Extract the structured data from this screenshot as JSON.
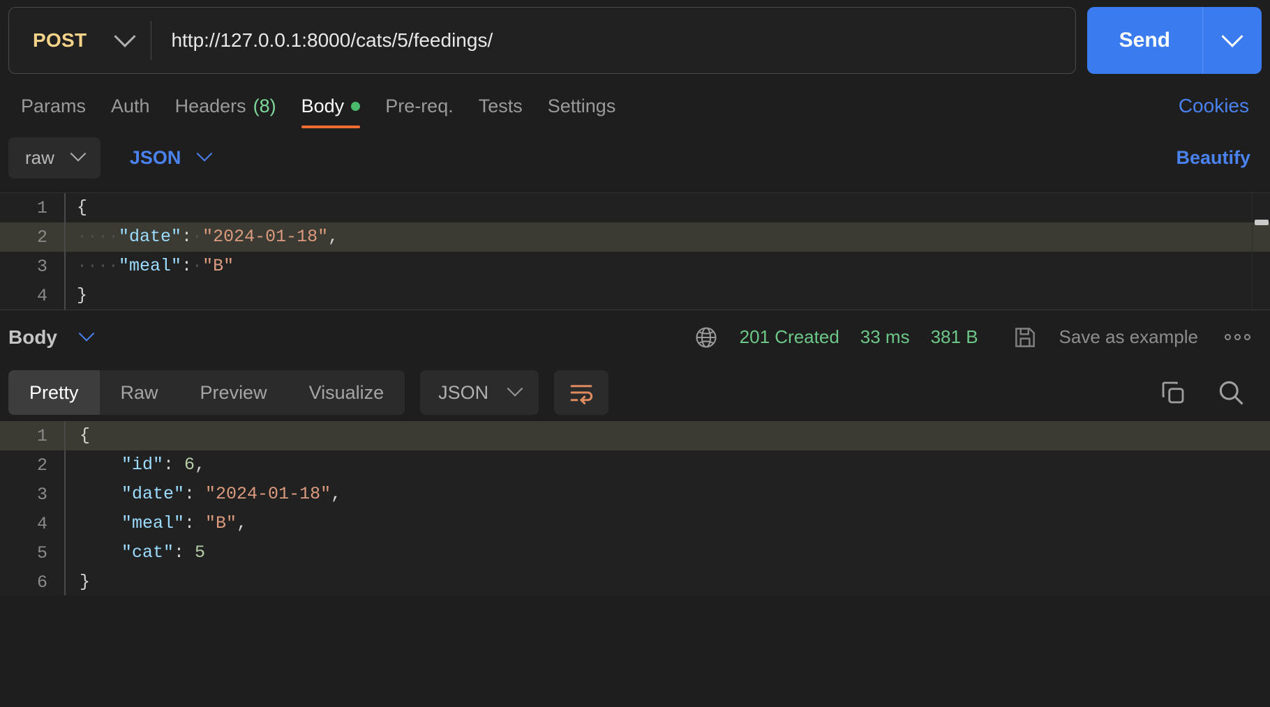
{
  "request": {
    "method": "POST",
    "url": "http://127.0.0.1:8000/cats/5/feedings/",
    "send_label": "Send",
    "tabs": [
      {
        "label": "Params",
        "active": false
      },
      {
        "label": "Auth",
        "active": false
      },
      {
        "label": "Headers",
        "count": "(8)",
        "active": false
      },
      {
        "label": "Body",
        "active": true,
        "dot": true
      },
      {
        "label": "Pre-req.",
        "active": false
      },
      {
        "label": "Tests",
        "active": false
      },
      {
        "label": "Settings",
        "active": false
      }
    ],
    "cookies_label": "Cookies",
    "body_mode": "raw",
    "body_format": "JSON",
    "beautify_label": "Beautify",
    "body_lines": [
      {
        "num": "1",
        "highlight": false,
        "tokens": [
          {
            "t": "pun",
            "v": "{"
          }
        ]
      },
      {
        "num": "2",
        "highlight": true,
        "tokens": [
          {
            "t": "ws",
            "v": "····"
          },
          {
            "t": "key",
            "v": "\"date\""
          },
          {
            "t": "pun",
            "v": ":"
          },
          {
            "t": "ws",
            "v": "·"
          },
          {
            "t": "str",
            "v": "\"2024-01-18\""
          },
          {
            "t": "pun",
            "v": ","
          }
        ]
      },
      {
        "num": "3",
        "highlight": false,
        "tokens": [
          {
            "t": "ws",
            "v": "····"
          },
          {
            "t": "key",
            "v": "\"meal\""
          },
          {
            "t": "pun",
            "v": ":"
          },
          {
            "t": "ws",
            "v": "·"
          },
          {
            "t": "str",
            "v": "\"B\""
          }
        ]
      },
      {
        "num": "4",
        "highlight": false,
        "tokens": [
          {
            "t": "pun",
            "v": "}"
          }
        ]
      }
    ]
  },
  "response": {
    "body_label": "Body",
    "status": "201 Created",
    "time": "33 ms",
    "size": "381 B",
    "save_example_label": "Save as example",
    "tabs": [
      {
        "label": "Pretty",
        "active": true
      },
      {
        "label": "Raw",
        "active": false
      },
      {
        "label": "Preview",
        "active": false
      },
      {
        "label": "Visualize",
        "active": false
      }
    ],
    "format": "JSON",
    "body_lines": [
      {
        "num": "1",
        "highlight": true,
        "tokens": [
          {
            "t": "pun",
            "v": "{"
          }
        ]
      },
      {
        "num": "2",
        "highlight": false,
        "tokens": [
          {
            "t": "pun",
            "v": "    "
          },
          {
            "t": "key",
            "v": "\"id\""
          },
          {
            "t": "pun",
            "v": ": "
          },
          {
            "t": "num",
            "v": "6"
          },
          {
            "t": "pun",
            "v": ","
          }
        ]
      },
      {
        "num": "3",
        "highlight": false,
        "tokens": [
          {
            "t": "pun",
            "v": "    "
          },
          {
            "t": "key",
            "v": "\"date\""
          },
          {
            "t": "pun",
            "v": ": "
          },
          {
            "t": "str",
            "v": "\"2024-01-18\""
          },
          {
            "t": "pun",
            "v": ","
          }
        ]
      },
      {
        "num": "4",
        "highlight": false,
        "tokens": [
          {
            "t": "pun",
            "v": "    "
          },
          {
            "t": "key",
            "v": "\"meal\""
          },
          {
            "t": "pun",
            "v": ": "
          },
          {
            "t": "str",
            "v": "\"B\""
          },
          {
            "t": "pun",
            "v": ","
          }
        ]
      },
      {
        "num": "5",
        "highlight": false,
        "tokens": [
          {
            "t": "pun",
            "v": "    "
          },
          {
            "t": "key",
            "v": "\"cat\""
          },
          {
            "t": "pun",
            "v": ": "
          },
          {
            "t": "num",
            "v": "5"
          }
        ]
      },
      {
        "num": "6",
        "highlight": false,
        "tokens": [
          {
            "t": "pun",
            "v": "}"
          }
        ]
      }
    ]
  },
  "colors": {
    "accent_blue": "#3a7bf0",
    "link_blue": "#4a82ef",
    "method_yellow": "#f5d48a",
    "status_green": "#6cc788",
    "tab_underline_orange": "#ef6c33",
    "wrap_icon_orange": "#e08b5f",
    "editor_bg": "#212121",
    "active_line": "#3b3b33"
  }
}
